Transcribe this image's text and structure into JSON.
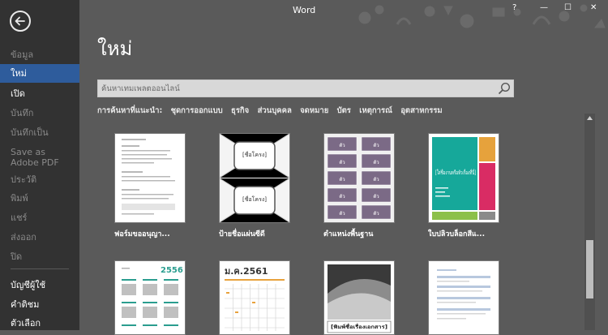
{
  "window": {
    "title": "Word",
    "help": "?",
    "minimize": "—",
    "maximize": "☐",
    "close": "✕"
  },
  "sidebar": {
    "items": [
      {
        "label": "ข้อมูล",
        "state": "dim"
      },
      {
        "label": "ใหม่",
        "state": "active"
      },
      {
        "label": "เปิด",
        "state": "bright"
      },
      {
        "label": "บันทึก",
        "state": "dim"
      },
      {
        "label": "บันทึกเป็น",
        "state": "dim"
      },
      {
        "label": "Save as Adobe PDF",
        "state": "dim"
      },
      {
        "label": "ประวัติ",
        "state": "dim"
      },
      {
        "label": "พิมพ์",
        "state": "dim"
      },
      {
        "label": "แชร์",
        "state": "dim"
      },
      {
        "label": "ส่งออก",
        "state": "dim"
      },
      {
        "label": "ปิด",
        "state": "dim"
      }
    ],
    "bottom_items": [
      {
        "label": "บัญชีผู้ใช้"
      },
      {
        "label": "คำติชม"
      },
      {
        "label": "ตัวเลือก"
      }
    ]
  },
  "main": {
    "heading": "ใหม่",
    "search_placeholder": "ค้นหาเทมเพลตออนไลน์",
    "suggested_label": "การค้นหาที่แนะนำ:",
    "suggested": [
      "ชุดการออกแบบ",
      "ธุรกิจ",
      "ส่วนบุคคล",
      "จดหมาย",
      "บัตร",
      "เหตุการณ์",
      "อุตสาหกรรม"
    ],
    "templates": [
      {
        "label": "ฟอร์มขออนุญา..."
      },
      {
        "label": "ป้ายชื่อแผ่นซีดี",
        "thumb_text": [
          "[ชื่อโครง]",
          "[ชื่อโครง]"
        ]
      },
      {
        "label": "ตำแหน่งพื้นฐาน",
        "thumb_text": "ตัว"
      },
      {
        "label": "ใบปลิวบล็อกสีแ...",
        "thumb_text": "[ใส่ชื่องานหรือหัวเรื่องที่นี่]",
        "colors": [
          "#e6a23c",
          "#16a89a",
          "#d92c64",
          "#8cc04a",
          "#8a8a8a"
        ]
      },
      {
        "thumb_text": "2556",
        "accent": "#2a9d8f"
      },
      {
        "thumb_text": "ม.ค.2561",
        "accent": "#e8a23c"
      },
      {
        "thumb_text": "[พิมพ์ชื่อเรื่องเอกสาร]"
      },
      {
        "thumb_text": ""
      }
    ]
  }
}
